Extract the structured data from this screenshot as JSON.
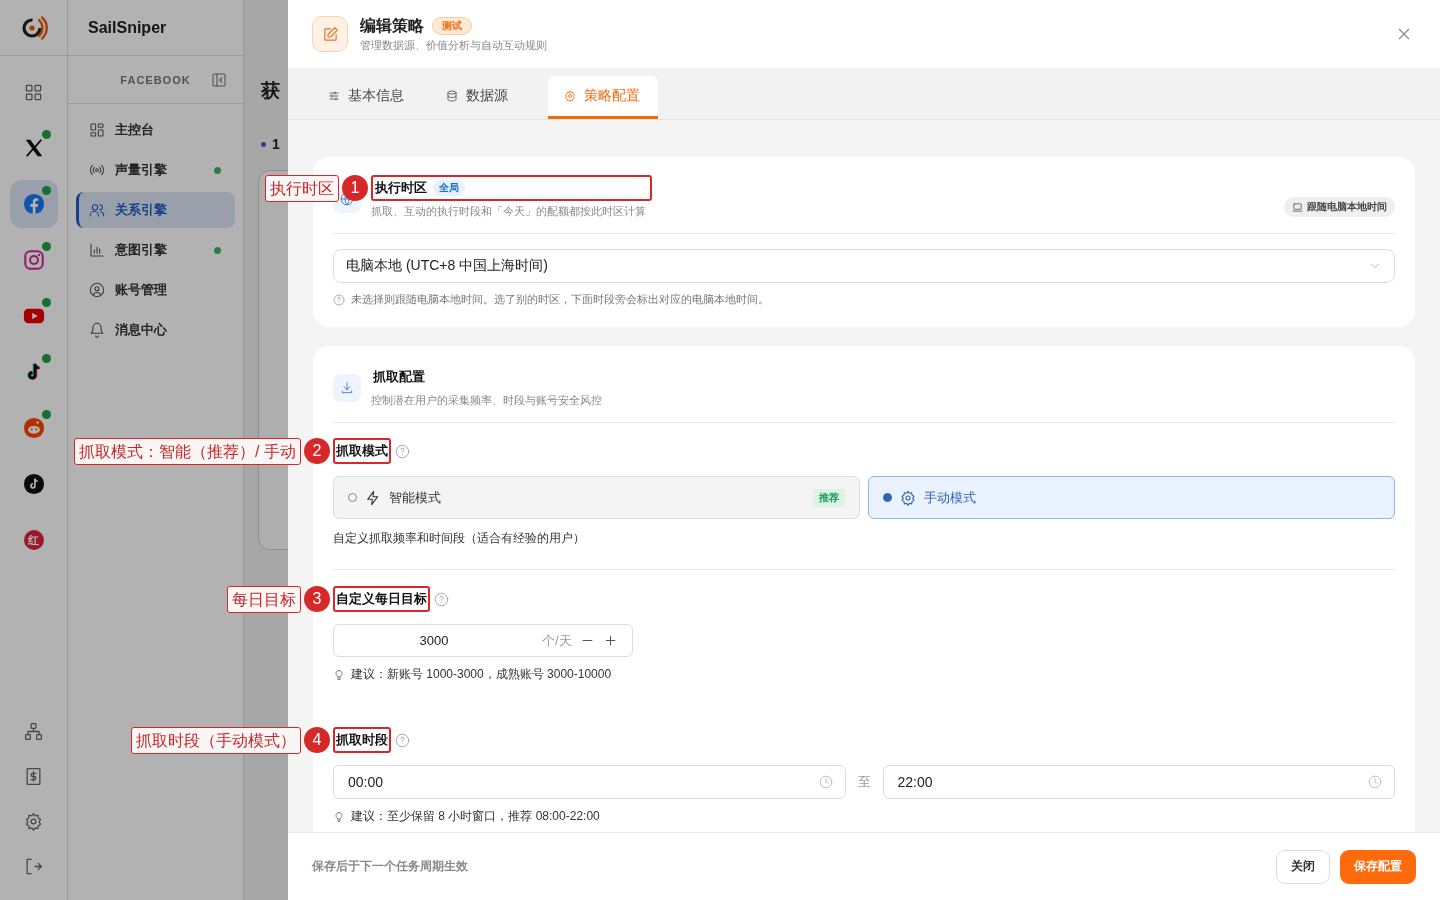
{
  "app": {
    "name": "SailSniper"
  },
  "rail": {
    "items": [
      {
        "kind": "grid",
        "selected": false,
        "online": false
      },
      {
        "kind": "x",
        "selected": false,
        "online": true
      },
      {
        "kind": "facebook",
        "selected": true,
        "online": true
      },
      {
        "kind": "instagram",
        "selected": false,
        "online": true
      },
      {
        "kind": "youtube",
        "selected": false,
        "online": true
      },
      {
        "kind": "tiktok",
        "selected": false,
        "online": true
      },
      {
        "kind": "reddit",
        "selected": false,
        "online": true
      },
      {
        "kind": "tiktok-round",
        "selected": false,
        "online": false
      },
      {
        "kind": "rednote",
        "label": "红",
        "selected": false,
        "online": false
      }
    ],
    "bottom": [
      {
        "kind": "sitemap"
      },
      {
        "kind": "billing"
      },
      {
        "kind": "settings"
      },
      {
        "kind": "logout"
      }
    ]
  },
  "sidebar": {
    "section": "FACEBOOK",
    "items": [
      {
        "label": "主控台",
        "selected": false,
        "online": false
      },
      {
        "label": "声量引擎",
        "selected": false,
        "online": true
      },
      {
        "label": "关系引擎",
        "selected": true,
        "online": false
      },
      {
        "label": "意图引擎",
        "selected": false,
        "online": true
      },
      {
        "label": "账号管理",
        "selected": false,
        "online": false
      },
      {
        "label": "消息中心",
        "selected": false,
        "online": false
      }
    ]
  },
  "background_page": {
    "title": "获",
    "step": "1"
  },
  "drawer": {
    "title": "编辑策略",
    "badge": "测试",
    "subtitle": "管理数据源、价值分析与自动互动规则",
    "tabs": [
      {
        "label": "基本信息",
        "selected": false
      },
      {
        "label": "数据源",
        "selected": false
      },
      {
        "label": "策略配置",
        "selected": true
      }
    ],
    "timezone_card": {
      "title": "执行时区",
      "badge": "全局",
      "highlighted": true,
      "description": "抓取、互动的执行时段和「今天」的配额都按此时区计算",
      "pill": "跟随电脑本地时间",
      "select_value": "电脑本地 (UTC+8 中国上海时间)",
      "help": "未选择则跟随电脑本地时间。选了别的时区，下面时段旁会标出对应的电脑本地时间。"
    },
    "crawl_card": {
      "title": "抓取配置",
      "description": "控制潜在用户的采集频率、时段与账号安全风控",
      "mode": {
        "label": "抓取模式",
        "highlighted": true,
        "options": [
          {
            "label": "智能模式",
            "badge": "推荐",
            "selected": false
          },
          {
            "label": "手动模式",
            "selected": true
          }
        ],
        "description": "自定义抓取频率和时间段（适合有经验的用户）"
      },
      "daily_target": {
        "label": "自定义每日目标",
        "highlighted": true,
        "value": "3000",
        "unit": "个/天",
        "tip": "建议：新账号 1000-3000，成熟账号 3000-10000"
      },
      "time_window": {
        "label": "抓取时段",
        "highlighted": true,
        "start": "00:00",
        "separator": "至",
        "end": "22:00",
        "tip": "建议：至少保留 8 小时窗口，推荐 08:00-22:00"
      }
    },
    "footer": {
      "note": "保存后于下一个任务周期生效",
      "buttons": [
        {
          "kind": "secondary",
          "label": "关闭"
        },
        {
          "kind": "primary",
          "label": "保存配置"
        }
      ]
    }
  },
  "annotations": [
    {
      "number": "1",
      "label": "执行时区"
    },
    {
      "number": "2",
      "label": "抓取模式：智能（推荐）/ 手动"
    },
    {
      "number": "3",
      "label": "每日目标"
    },
    {
      "number": "4",
      "label": "抓取时段（手动模式）"
    }
  ]
}
